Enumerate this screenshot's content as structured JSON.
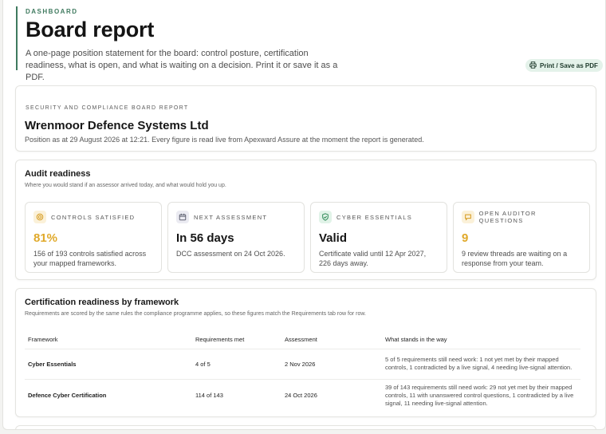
{
  "header": {
    "eyebrow": "DASHBOARD",
    "title": "Board report",
    "subtitle": "A one-page position statement for the board: control posture, certification readiness, what is open, and what is waiting on a decision. Print it or save it as a PDF.",
    "print_label": "Print / Save as PDF"
  },
  "report": {
    "label": "SECURITY AND COMPLIANCE BOARD REPORT",
    "org_name": "Wrenmoor Defence Systems Ltd",
    "position_line": "Position as at 29 August 2026 at 12:21. Every figure is read live from Apexward Assure at the moment the report is generated."
  },
  "readiness": {
    "title": "Audit readiness",
    "subtitle": "Where you would stand if an assessor arrived today, and what would hold you up.",
    "stats": [
      {
        "label": "CONTROLS SATISFIED",
        "value": "81%",
        "note": "156 of 193 controls satisfied across your mapped frameworks.",
        "icon": "target-icon",
        "value_color": "#e0a92a",
        "icon_bg": "#fbf1d9",
        "icon_color": "#d59a1d"
      },
      {
        "label": "NEXT ASSESSMENT",
        "value": "In 56 days",
        "note": "DCC assessment on 24 Oct 2026.",
        "icon": "calendar-icon",
        "value_color": "#161616",
        "icon_bg": "#ebebf2",
        "icon_color": "#5f6372"
      },
      {
        "label": "CYBER ESSENTIALS",
        "value": "Valid",
        "note": "Certificate valid until 12 Apr 2027, 226 days away.",
        "icon": "shield-check-icon",
        "value_color": "#161616",
        "icon_bg": "#e1f3e8",
        "icon_color": "#2f8a58"
      },
      {
        "label": "OPEN AUDITOR QUESTIONS",
        "value": "9",
        "note": "9 review threads are waiting on a response from your team.",
        "icon": "chat-icon",
        "value_color": "#e0a92a",
        "icon_bg": "#fbf1d9",
        "icon_color": "#d59a1d"
      }
    ]
  },
  "frameworks": {
    "title": "Certification readiness by framework",
    "subtitle": "Requirements are scored by the same rules the compliance programme applies, so these figures match the Requirements tab row for row.",
    "columns": [
      "Framework",
      "Requirements met",
      "Assessment",
      "What stands in the way"
    ],
    "rows": [
      {
        "framework": "Cyber Essentials",
        "met": "4 of 5",
        "assessment": "2 Nov 2026",
        "blockers": "5 of 5 requirements still need work: 1 not yet met by their mapped controls, 1 contradicted by a live signal, 4 needing live-signal attention."
      },
      {
        "framework": "Defence Cyber Certification",
        "met": "114 of 143",
        "assessment": "24 Oct 2026",
        "blockers": "39 of 143 requirements still need work: 29 not yet met by their mapped controls, 11 with unanswered control questions, 1 contradicted by a live signal, 11 needing live-signal attention."
      }
    ]
  }
}
